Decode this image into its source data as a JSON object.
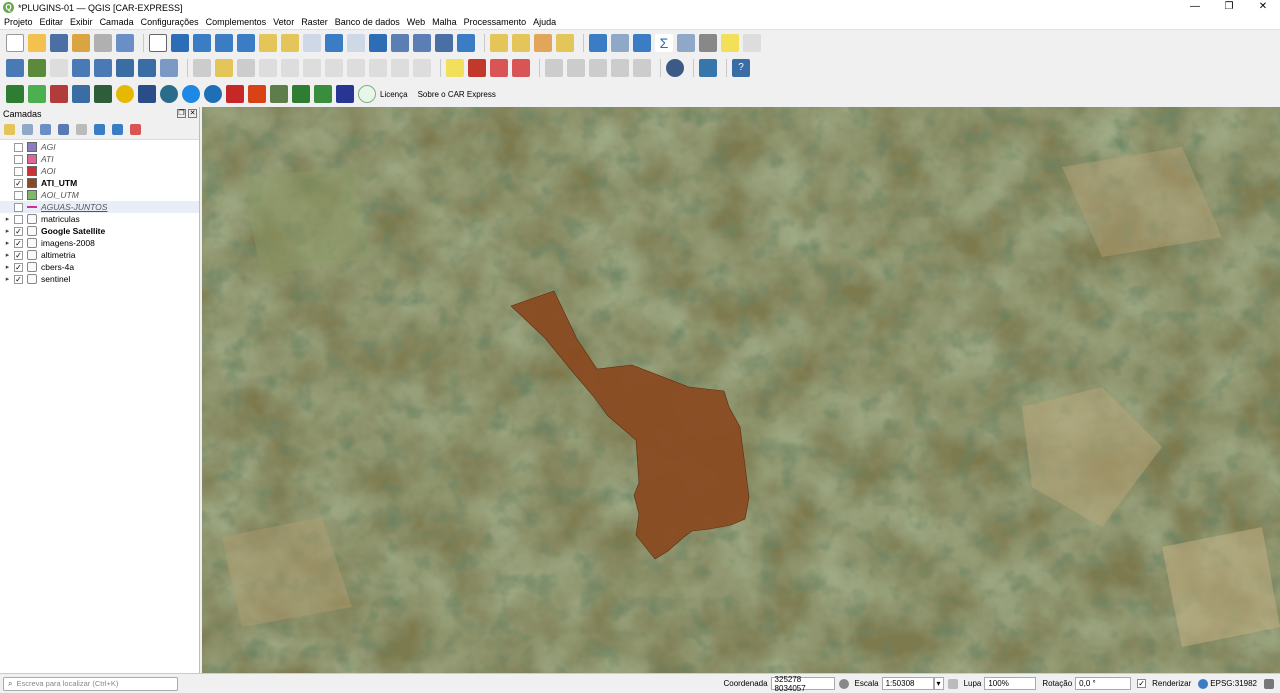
{
  "window": {
    "title": "*PLUGINS-01 — QGIS [CAR-EXPRESS]",
    "controls": [
      "—",
      "❐",
      "✕"
    ]
  },
  "menu": [
    "Projeto",
    "Editar",
    "Exibir",
    "Camada",
    "Configurações",
    "Complementos",
    "Vetor",
    "Raster",
    "Banco de dados",
    "Web",
    "Malha",
    "Processamento",
    "Ajuda"
  ],
  "plugins_toolbar": {
    "license_label": "Licença",
    "about_label": "Sobre o CAR Express"
  },
  "layers_panel": {
    "title": "Camadas",
    "layers": [
      {
        "name": "AGI",
        "checked": false,
        "symbol_color": "#8e7cc3",
        "style": "italic",
        "kind": "vector"
      },
      {
        "name": "ATI",
        "checked": false,
        "symbol_color": "#e06699",
        "style": "italic",
        "kind": "vector"
      },
      {
        "name": "AOI",
        "checked": false,
        "symbol_color": "#cc3333",
        "style": "italic",
        "kind": "vector"
      },
      {
        "name": "ATI_UTM",
        "checked": true,
        "symbol_color": "#8a4b22",
        "style": "bold",
        "kind": "vector"
      },
      {
        "name": "AOI_UTM",
        "checked": false,
        "symbol_color": "#7fb86a",
        "style": "italic",
        "kind": "vector"
      },
      {
        "name": "AGUAS-JUNTOS",
        "checked": false,
        "symbol_color": "#cc3399",
        "style": "italic",
        "kind": "line"
      },
      {
        "name": "matriculas",
        "checked": false,
        "symbol_color": "",
        "style": "normal",
        "kind": "group"
      },
      {
        "name": "Google Satellite",
        "checked": true,
        "symbol_color": "",
        "style": "bold",
        "kind": "group"
      },
      {
        "name": "imagens-2008",
        "checked": true,
        "symbol_color": "",
        "style": "normal",
        "kind": "group"
      },
      {
        "name": "altimetria",
        "checked": true,
        "symbol_color": "",
        "style": "normal",
        "kind": "group"
      },
      {
        "name": "cbers-4a",
        "checked": true,
        "symbol_color": "",
        "style": "normal",
        "kind": "group"
      },
      {
        "name": "sentinel",
        "checked": true,
        "symbol_color": "",
        "style": "normal",
        "kind": "group"
      }
    ]
  },
  "status": {
    "locator_placeholder": "Escreva para localizar (Ctrl+K)",
    "coordinate_label": "Coordenada",
    "coordinate_value": "325278  8034057",
    "scale_label": "Escala",
    "scale_value": "1:50308",
    "magnifier_label": "Lupa",
    "magnifier_value": "100%",
    "rotation_label": "Rotação",
    "rotation_value": "0,0 °",
    "render_label": "Renderizar",
    "crs_label": "EPSG:31982"
  },
  "map": {
    "polygon_color": "#8a4b22",
    "base_color": "#5a6a3a"
  }
}
